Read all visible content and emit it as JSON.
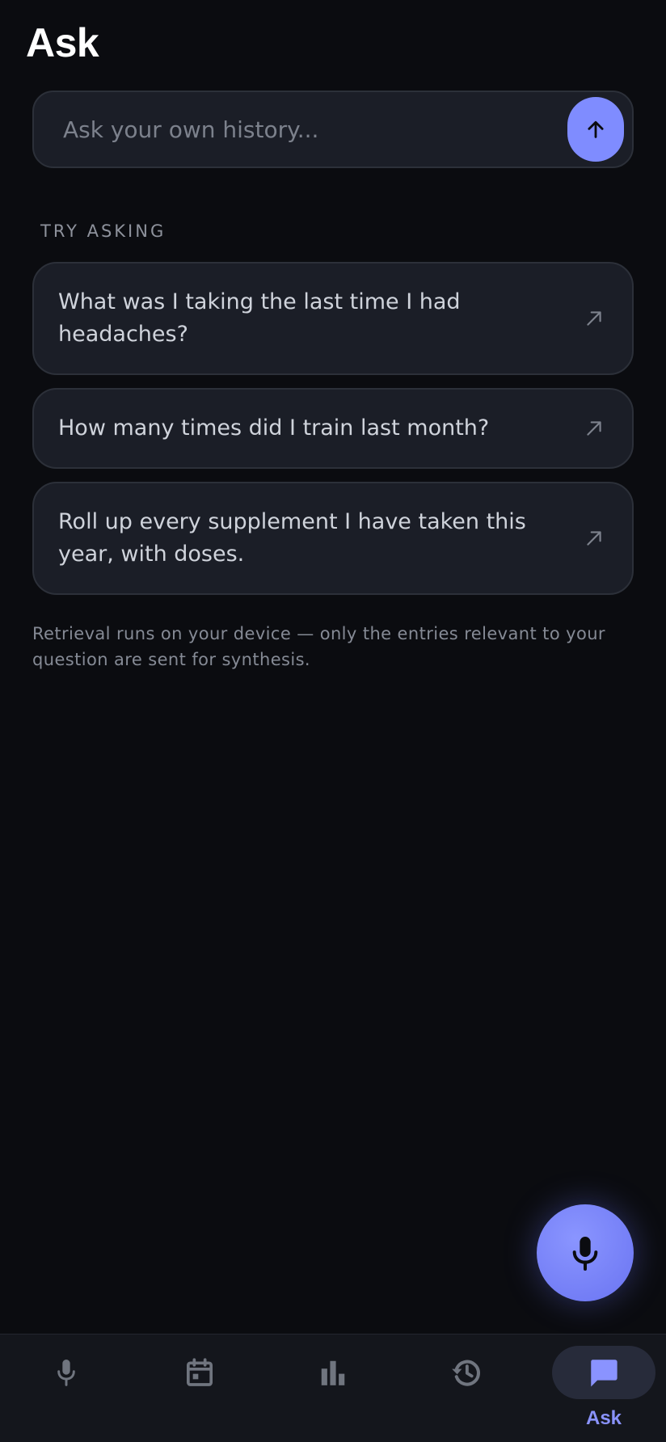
{
  "header": {
    "title": "Ask"
  },
  "search": {
    "placeholder": "Ask your own history..."
  },
  "suggestions": {
    "heading": "TRY ASKING",
    "items": [
      {
        "text": "What was I taking the last time I had headaches?"
      },
      {
        "text": "How many times did I train last month?"
      },
      {
        "text": "Roll up every supplement I have taken this year, with doses."
      }
    ]
  },
  "privacy_note": "Retrieval runs on your device — only the entries relevant to your question are sent for synthesis.",
  "nav": {
    "items": [
      {
        "icon": "mic-icon",
        "label": ""
      },
      {
        "icon": "calendar-icon",
        "label": ""
      },
      {
        "icon": "bar-chart-icon",
        "label": ""
      },
      {
        "icon": "history-icon",
        "label": ""
      },
      {
        "icon": "chat-icon",
        "label": "Ask",
        "active": true
      }
    ]
  },
  "colors": {
    "background": "#0b0c10",
    "accent": "#7f8cff",
    "card": "#1b1e27",
    "nav_background": "#14161c"
  }
}
